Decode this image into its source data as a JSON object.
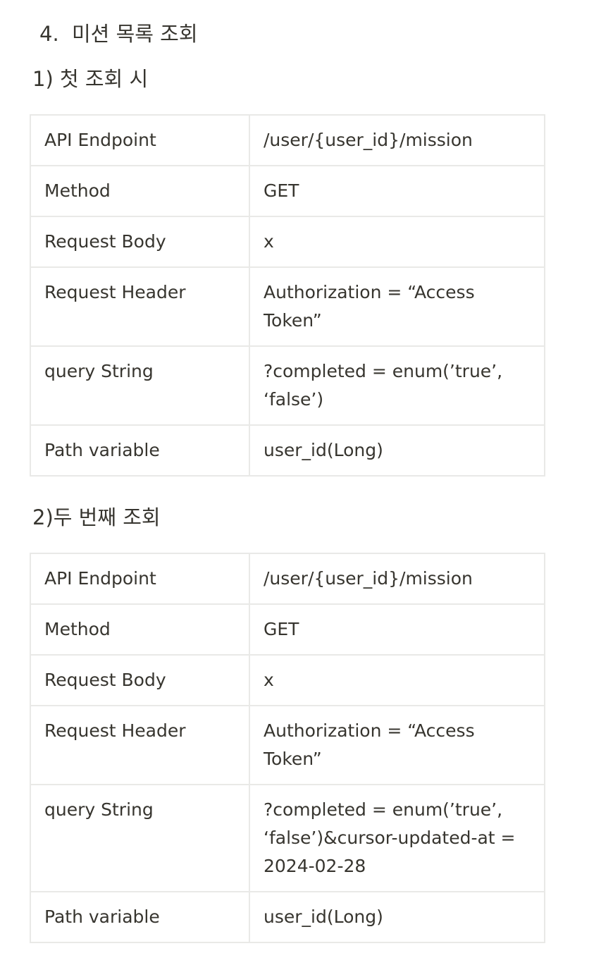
{
  "section": {
    "number": "4.",
    "title": "미션 목록 조회"
  },
  "subsections": [
    {
      "heading": "1) 첫 조회 시",
      "rows": [
        {
          "key": "API Endpoint",
          "value": "/user/{user_id}/mission"
        },
        {
          "key": "Method",
          "value": "GET"
        },
        {
          "key": "Request Body",
          "value": "x"
        },
        {
          "key": "Request Header",
          "value": "Authorization = “Access Token”"
        },
        {
          "key": "query String",
          "value": "?completed = enum(’true’, ‘false’)"
        },
        {
          "key": "Path variable",
          "value": "user_id(Long)"
        }
      ]
    },
    {
      "heading": "2)두 번째 조회",
      "rows": [
        {
          "key": "API Endpoint",
          "value": "/user/{user_id}/mission"
        },
        {
          "key": "Method",
          "value": "GET"
        },
        {
          "key": "Request Body",
          "value": "x"
        },
        {
          "key": "Request Header",
          "value": "Authorization = “Access Token”"
        },
        {
          "key": "query String",
          "value": "?completed = enum(’true’, ‘false’)&cursor-updated-at = 2024-02-28"
        },
        {
          "key": "Path variable",
          "value": "user_id(Long)"
        }
      ]
    }
  ]
}
